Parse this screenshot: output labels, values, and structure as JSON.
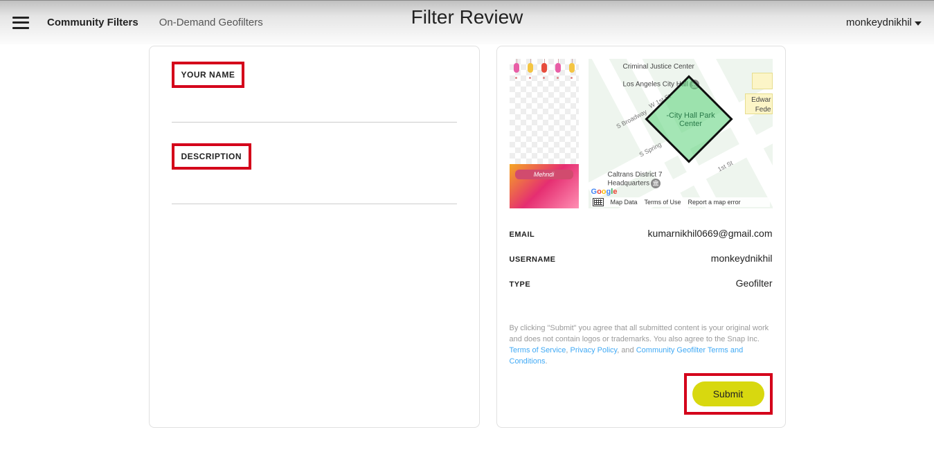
{
  "header": {
    "title": "Filter Review",
    "nav": {
      "community": "Community Filters",
      "ondemand": "On-Demand Geofilters"
    },
    "user": "monkeydnikhil"
  },
  "form": {
    "name_label": "YOUR NAME",
    "description_label": "DESCRIPTION",
    "name_value": "",
    "description_value": ""
  },
  "preview": {
    "filter_text": "Mehndi"
  },
  "map": {
    "poi": {
      "criminal": "Criminal Justice Center",
      "cityhall": "Los Angeles City Hall",
      "edward": "Edwar",
      "feder": "Fede",
      "caltrans": "Caltrans District 7 Headquarters"
    },
    "streets": {
      "broadway": "S Broadway",
      "spring": "S Spring",
      "w1st": "W 1st St",
      "e1st": "1st St"
    },
    "geofence_label": "-City Hall Park Center",
    "footer": {
      "map_data": "Map Data",
      "terms": "Terms of Use",
      "report": "Report a map error"
    }
  },
  "info": {
    "email_label": "EMAIL",
    "email_value": "kumarnikhil0669@gmail.com",
    "username_label": "USERNAME",
    "username_value": "monkeydnikhil",
    "type_label": "TYPE",
    "type_value": "Geofilter"
  },
  "legal": {
    "pre": "By clicking \"Submit\" you agree that all submitted content is your original work and does not contain logos or trademarks. You also agree to the Snap Inc. ",
    "tos": "Terms of Service",
    "sep1": ", ",
    "privacy": "Privacy Policy",
    "sep2": ", and ",
    "geo_terms": "Community Geofilter Terms and Conditions",
    "end": "."
  },
  "actions": {
    "submit": "Submit"
  }
}
